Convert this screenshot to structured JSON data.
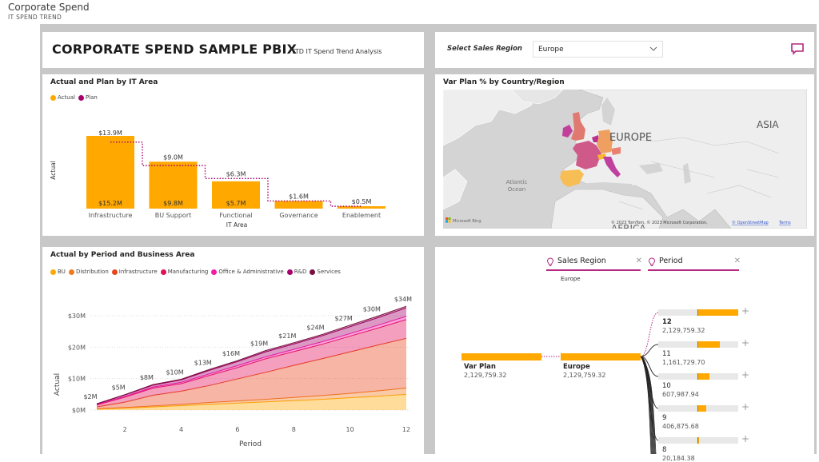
{
  "app": {
    "title": "Corporate Spend",
    "subtitle": "IT SPEND TREND"
  },
  "header": {
    "report_title": "CORPORATE SPEND SAMPLE PBIX",
    "report_subtitle": "YTD IT Spend Trend Analysis"
  },
  "slicer": {
    "label": "Select Sales Region",
    "selected": "Europe",
    "icons": {
      "dropdown": "chevron-down-icon",
      "comment": "comment-icon"
    }
  },
  "colors": {
    "actual": "#FFA800",
    "plan": "#A7006B",
    "accent": "#B4287F"
  },
  "bar_visual": {
    "title": "Actual and Plan by IT Area",
    "chart_data": {
      "type": "bar",
      "title": "Actual and Plan by IT Area",
      "xlabel": "IT Area",
      "ylabel": "Actual",
      "legend": [
        {
          "name": "Actual",
          "color": "#FFA800"
        },
        {
          "name": "Plan",
          "color": "#A7006B"
        }
      ],
      "legend_position": "top-left",
      "categories": [
        "Infrastructure",
        "BU Support",
        "Functional",
        "Governance",
        "Enablement"
      ],
      "series": [
        {
          "name": "Actual",
          "values": [
            15.2,
            9.8,
            5.7,
            1.6,
            0.5
          ],
          "labels": [
            "$15.2M",
            "$9.8M",
            "$5.7M",
            "",
            ""
          ]
        },
        {
          "name": "Plan",
          "values": [
            13.9,
            9.0,
            6.3,
            1.6,
            0.5
          ],
          "labels": [
            "$13.9M",
            "$9.0M",
            "$6.3M",
            "$1.6M",
            "$0.5M"
          ]
        }
      ],
      "unit": "$M"
    }
  },
  "map_visual": {
    "title": "Var Plan % by Country/Region",
    "labels": {
      "europe": "EUROPE",
      "asia": "ASIA",
      "africa": "AFRICA",
      "ocean": "Atlantic Ocean"
    },
    "attribution": "© 2023 TomTom, © 2023 Microsoft Corporation, ",
    "osm_link": "© OpenStreetMap",
    "terms_link": "Terms",
    "bing_label": "Microsoft Bing",
    "countries": [
      {
        "name": "Ireland",
        "color": "#C2409A"
      },
      {
        "name": "United Kingdom",
        "color": "#E07A70"
      },
      {
        "name": "France",
        "color": "#CF5A8A"
      },
      {
        "name": "Germany",
        "color": "#EFA060"
      },
      {
        "name": "Netherlands",
        "color": "#B9308F"
      },
      {
        "name": "Spain",
        "color": "#F6BE55"
      },
      {
        "name": "Italy",
        "color": "#C040A0"
      },
      {
        "name": "Switzerland",
        "color": "#F6B830"
      },
      {
        "name": "Austria",
        "color": "#E98070"
      }
    ]
  },
  "area_visual": {
    "title": "Actual by Period and Business Area",
    "chart_data": {
      "type": "area",
      "stacked": true,
      "title": "Actual by Period and Business Area",
      "xlabel": "Period",
      "ylabel": "Actual",
      "x": [
        1,
        2,
        3,
        4,
        5,
        6,
        7,
        8,
        9,
        10,
        11,
        12
      ],
      "xticks": [
        2,
        4,
        6,
        8,
        10,
        12
      ],
      "yticks": [
        "$0M",
        "$10M",
        "$20M",
        "$30M"
      ],
      "ylim": [
        0,
        35
      ],
      "grid": true,
      "legend_position": "top-left",
      "totals_labels": [
        "$2M",
        "$5M",
        "$8M",
        "$10M",
        "$13M",
        "$16M",
        "$19M",
        "$21M",
        "$24M",
        "$27M",
        "$30M",
        "$34M"
      ],
      "series": [
        {
          "name": "BU",
          "color": "#FFA800",
          "values": [
            0.3,
            0.6,
            1.0,
            1.4,
            1.8,
            2.2,
            2.6,
            3.0,
            3.4,
            3.9,
            4.4,
            5.0
          ]
        },
        {
          "name": "Distribution",
          "color": "#F07A1F",
          "values": [
            0.1,
            0.2,
            0.3,
            0.4,
            0.6,
            0.7,
            0.8,
            1.0,
            1.2,
            1.4,
            1.7,
            2.0
          ]
        },
        {
          "name": "Infrastructure",
          "color": "#E8451E",
          "values": [
            0.6,
            1.7,
            3.4,
            4.2,
            5.4,
            7.0,
            8.6,
            10.2,
            11.7,
            13.2,
            14.6,
            15.8
          ]
        },
        {
          "name": "Manufacturing",
          "color": "#E0105A",
          "values": [
            0.6,
            1.6,
            2.3,
            2.4,
            3.2,
            3.6,
            4.3,
            4.4,
            4.6,
            5.0,
            5.4,
            6.0
          ]
        },
        {
          "name": "Office & Administrative",
          "color": "#F41BA7",
          "values": [
            0.1,
            0.2,
            0.3,
            0.4,
            0.5,
            0.6,
            0.6,
            0.7,
            0.8,
            0.8,
            0.9,
            1.0
          ]
        },
        {
          "name": "R&D",
          "color": "#A7006B",
          "values": [
            0.2,
            0.5,
            0.6,
            0.8,
            1.1,
            1.3,
            1.6,
            1.7,
            1.9,
            2.2,
            2.4,
            2.7
          ]
        },
        {
          "name": "Services",
          "color": "#7A0F3E",
          "values": [
            0.1,
            0.1,
            0.2,
            0.2,
            0.3,
            0.3,
            0.4,
            0.4,
            0.4,
            0.5,
            0.5,
            0.5
          ]
        }
      ]
    }
  },
  "tree_visual": {
    "fields": [
      {
        "label": "Sales Region",
        "sub": "Europe"
      },
      {
        "label": "Period",
        "sub": ""
      }
    ],
    "root": {
      "label": "Var Plan",
      "value": "2,129,759.32"
    },
    "level1": {
      "label": "Europe",
      "value": "2,129,759.32"
    },
    "level2": [
      {
        "label": "12",
        "value": "2,129,759.32",
        "fraction": 1.0,
        "bold": true
      },
      {
        "label": "11",
        "value": "1,161,729.70",
        "fraction": 0.545
      },
      {
        "label": "10",
        "value": "607,987.94",
        "fraction": 0.285
      },
      {
        "label": "9",
        "value": "406,875.68",
        "fraction": 0.19
      },
      {
        "label": "8",
        "value": "20,184.38",
        "fraction": 0.01
      }
    ]
  }
}
